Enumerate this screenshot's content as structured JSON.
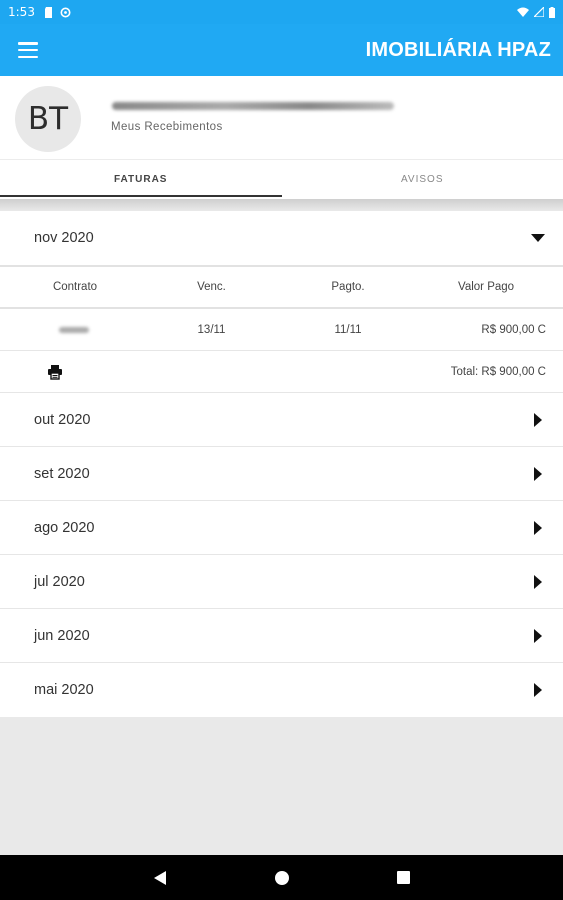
{
  "status_bar": {
    "time": "1:53"
  },
  "app_bar": {
    "title": "IMOBILIÁRIA HPAZ"
  },
  "profile": {
    "initials": "BT",
    "subtitle": "Meus Recebimentos"
  },
  "tabs": [
    {
      "label": "FATURAS",
      "active": true
    },
    {
      "label": "AVISOS",
      "active": false
    }
  ],
  "months": {
    "expanded": {
      "label": "nov 2020"
    },
    "collapsed": [
      {
        "label": "out 2020"
      },
      {
        "label": "set 2020"
      },
      {
        "label": "ago 2020"
      },
      {
        "label": "jul 2020"
      },
      {
        "label": "jun 2020"
      },
      {
        "label": "mai 2020"
      }
    ]
  },
  "table": {
    "headers": {
      "contrato": "Contrato",
      "venc": "Venc.",
      "pagto": "Pagto.",
      "valor": "Valor Pago"
    },
    "rows": [
      {
        "venc": "13/11",
        "pagto": "11/11",
        "valor": "R$ 900,00 C"
      }
    ],
    "total": "Total: R$ 900,00 C"
  },
  "colors": {
    "primary": "#20a9f3",
    "status_bar": "#1ea7f1",
    "nav_bar": "#000000",
    "background": "#e9e9e9"
  }
}
